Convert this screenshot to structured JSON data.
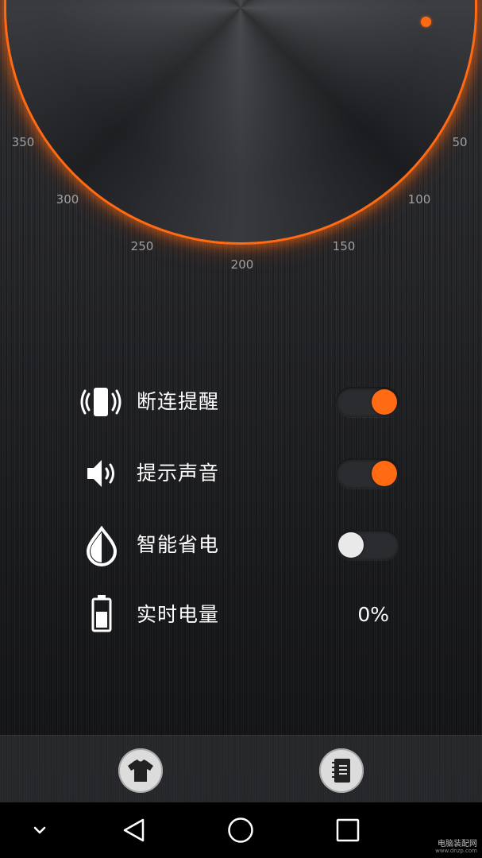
{
  "dial": {
    "scale_labels": [
      "350",
      "50",
      "300",
      "100",
      "250",
      "150",
      "200"
    ],
    "accent_color": "#ff6a13"
  },
  "settings": [
    {
      "icon": "vibrate-icon",
      "label": "断连提醒",
      "control": "toggle",
      "enabled": true
    },
    {
      "icon": "speaker-icon",
      "label": "提示声音",
      "control": "toggle",
      "enabled": true
    },
    {
      "icon": "water-drop-icon",
      "label": "智能省电",
      "control": "toggle",
      "enabled": false
    },
    {
      "icon": "battery-icon",
      "label": "实时电量",
      "control": "value",
      "value": "0%"
    }
  ],
  "bottom_bar": {
    "buttons": [
      {
        "icon": "tshirt-icon"
      },
      {
        "icon": "notebook-icon"
      }
    ]
  },
  "nav": {
    "icons": [
      "chevron-down-icon",
      "back-triangle-icon",
      "home-circle-icon",
      "recents-square-icon"
    ]
  },
  "watermark": {
    "text": "电脑装配网",
    "sub": "www.dnzp.com"
  }
}
